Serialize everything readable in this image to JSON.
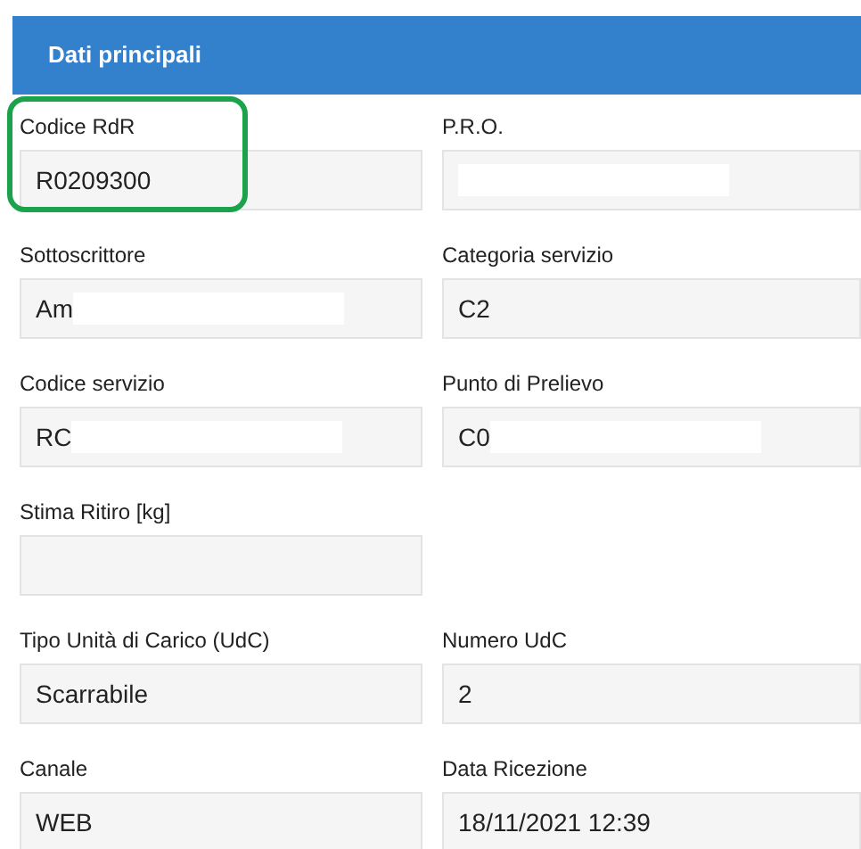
{
  "section": {
    "title": "Dati principali"
  },
  "rows": [
    {
      "cells": [
        {
          "label": "Codice RdR",
          "value": "R0209300",
          "redacted": false,
          "highlighted": true
        },
        {
          "label": "P.R.O.",
          "redacted": true,
          "highlighted": false
        }
      ]
    },
    {
      "cells": [
        {
          "label": "Sottoscrittore",
          "value": "Am",
          "redacted": true,
          "highlighted": false
        },
        {
          "label": "Categoria servizio",
          "value": "C2",
          "redacted": false,
          "highlighted": false
        }
      ]
    },
    {
      "cells": [
        {
          "label": "Codice servizio",
          "value": "RC",
          "redacted": true,
          "highlighted": false
        },
        {
          "label": "Punto di Prelievo",
          "value": "C0",
          "redacted": true,
          "highlighted": false
        }
      ]
    },
    {
      "cells": [
        {
          "label": "Stima Ritiro [kg]",
          "redacted": false,
          "highlighted": false
        }
      ]
    },
    {
      "cells": [
        {
          "label": "Tipo Unità di Carico (UdC)",
          "value": "Scarrabile",
          "redacted": false,
          "highlighted": false
        },
        {
          "label": "Numero UdC",
          "value": "2",
          "redacted": false,
          "highlighted": false
        }
      ]
    },
    {
      "cells": [
        {
          "label": "Canale",
          "value": "WEB",
          "redacted": false,
          "highlighted": false
        },
        {
          "label": "Data Ricezione",
          "value": "18/11/2021 12:39",
          "redacted": false,
          "highlighted": false
        }
      ]
    }
  ]
}
